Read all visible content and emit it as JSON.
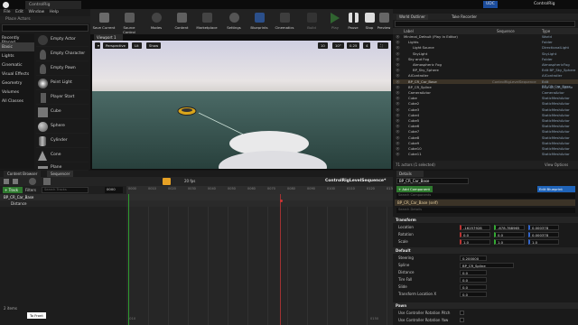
{
  "titlebar": {
    "tab_label": "ControlRig",
    "project_name": "ControlRig",
    "tab_small": "UDC"
  },
  "menu": [
    "File",
    "Edit",
    "Window",
    "Help"
  ],
  "place_actors": {
    "header": "Place Actors",
    "search_placeholder": "Search Classes",
    "categories": [
      "Recently Placed",
      "Basic",
      "Lights",
      "Cinematic",
      "Visual Effects",
      "Geometry",
      "Volumes",
      "All Classes"
    ],
    "selected_category": "Basic",
    "items": [
      "Empty Actor",
      "Empty Character",
      "Empty Pawn",
      "Point Light",
      "Player Start",
      "Cube",
      "Sphere",
      "Cylinder",
      "Cone",
      "Plane"
    ]
  },
  "toolbar": {
    "buttons": [
      "Save Current",
      "Source Control",
      "Modes",
      "Content",
      "Marketplace",
      "Settings",
      "Blueprints",
      "Cinematics",
      "Build",
      "Play",
      "Pause",
      "Stop",
      "Preview"
    ]
  },
  "viewport": {
    "tab": "Viewport 1",
    "perspective": "Perspective",
    "lit": "Lit",
    "show": "Show",
    "grid": "10",
    "angle": "10°",
    "scale": "0.25",
    "speed": "4"
  },
  "outliner": {
    "tabs": [
      "World Outliner",
      "Take Recorder"
    ],
    "search_placeholder": "Search...",
    "col_label": "Label",
    "col_sequence": "Sequence",
    "col_type": "Type",
    "rows": [
      {
        "label": "Minimal_Default (Play In Editor)",
        "seq": "",
        "type": "World",
        "indent": 0
      },
      {
        "label": "Lights",
        "seq": "",
        "type": "Folder",
        "indent": 1
      },
      {
        "label": "Light Source",
        "seq": "",
        "type": "DirectionalLight",
        "indent": 2
      },
      {
        "label": "SkyLight",
        "seq": "",
        "type": "SkyLight",
        "indent": 2
      },
      {
        "label": "Sky and Fog",
        "seq": "",
        "type": "Folder",
        "indent": 1
      },
      {
        "label": "Atmospheric Fog",
        "seq": "",
        "type": "AtmosphericFog",
        "indent": 2
      },
      {
        "label": "BP_Sky_Sphere",
        "seq": "",
        "type": "Edit BP_Sky_Sphere",
        "indent": 2
      },
      {
        "label": "AIController",
        "seq": "",
        "type": "AIController",
        "indent": 1
      },
      {
        "label": "BP_CR_Car_Base",
        "seq": "ControlRigLevelSequence",
        "type": "Edit BP_CR_Car_Base",
        "indent": 1,
        "hl": true
      },
      {
        "label": "BP_CR_Spline",
        "seq": "",
        "type": "Edit BP_CR_Spline",
        "indent": 1
      },
      {
        "label": "CameraActor",
        "seq": "",
        "type": "CameraActor",
        "indent": 1
      },
      {
        "label": "Cube",
        "seq": "",
        "type": "StaticMeshActor",
        "indent": 1
      },
      {
        "label": "Cube2",
        "seq": "",
        "type": "StaticMeshActor",
        "indent": 1
      },
      {
        "label": "Cube3",
        "seq": "",
        "type": "StaticMeshActor",
        "indent": 1
      },
      {
        "label": "Cube4",
        "seq": "",
        "type": "StaticMeshActor",
        "indent": 1
      },
      {
        "label": "Cube5",
        "seq": "",
        "type": "StaticMeshActor",
        "indent": 1
      },
      {
        "label": "Cube6",
        "seq": "",
        "type": "StaticMeshActor",
        "indent": 1
      },
      {
        "label": "Cube7",
        "seq": "",
        "type": "StaticMeshActor",
        "indent": 1
      },
      {
        "label": "Cube8",
        "seq": "",
        "type": "StaticMeshActor",
        "indent": 1
      },
      {
        "label": "Cube9",
        "seq": "",
        "type": "StaticMeshActor",
        "indent": 1
      },
      {
        "label": "Cube10",
        "seq": "",
        "type": "StaticMeshActor",
        "indent": 1
      },
      {
        "label": "Cube11",
        "seq": "",
        "type": "StaticMeshActor",
        "indent": 1
      }
    ],
    "footer": "71 actors (1 selected)",
    "view_options": "View Options"
  },
  "sequencer": {
    "tabs": [
      "Content Browser",
      "Sequencer"
    ],
    "track_btn": "+ Track",
    "filters": "Filters",
    "search_placeholder": "Search Tracks",
    "fps": "20 fps",
    "sequence_name": "ControlRigLevelSequence*",
    "frame": "0000",
    "tracks": [
      "BP_CR_Car_Base",
      "Distance"
    ],
    "ruler": [
      "0000",
      "0010",
      "0020",
      "0030",
      "0040",
      "0050",
      "0060",
      "0070",
      "0080",
      "0090",
      "0100",
      "0110",
      "0120",
      "0130"
    ],
    "bottom_left": "-010",
    "bottom_right": "0150",
    "items_count": "2 items",
    "tooltip": "To Front"
  },
  "details": {
    "tab": "Details",
    "actor_name": "BP_CR_Car_Base",
    "edit_blueprint": "Edit Blueprint",
    "add_component": "+ Add Component",
    "search_components": "Search Components",
    "component_self": "BP_CR_Car_Base (self)",
    "search_details": "Search Details",
    "transform": {
      "header": "Transform",
      "location_label": "Location",
      "rotation_label": "Rotation",
      "scale_label": "Scale",
      "location": [
        "-16257928",
        "-678.788965",
        "0.000378"
      ],
      "rotation": [
        "0.0",
        "0.0",
        "0.000378"
      ],
      "scale": [
        "1.0",
        "1.0",
        "1.0"
      ]
    },
    "default": {
      "header": "Default",
      "rows": [
        {
          "k": "Steering",
          "v": "0.200000"
        },
        {
          "k": "Spline",
          "v": "BP_CR_Spline"
        },
        {
          "k": "Distance",
          "v": "0.0"
        },
        {
          "k": "Tire Fall",
          "v": "0.0"
        },
        {
          "k": "Slide",
          "v": "0.0"
        },
        {
          "k": "Transform Location X",
          "v": "0.0"
        }
      ]
    },
    "pawn": {
      "header": "Pawn",
      "rows": [
        "Use Controller Rotation Pitch",
        "Use Controller Rotation Yaw"
      ]
    }
  },
  "colors": {
    "accent": "#e6a125",
    "select": "#1f63b8",
    "play": "#3ea63e",
    "hilite": "#3b3327"
  }
}
